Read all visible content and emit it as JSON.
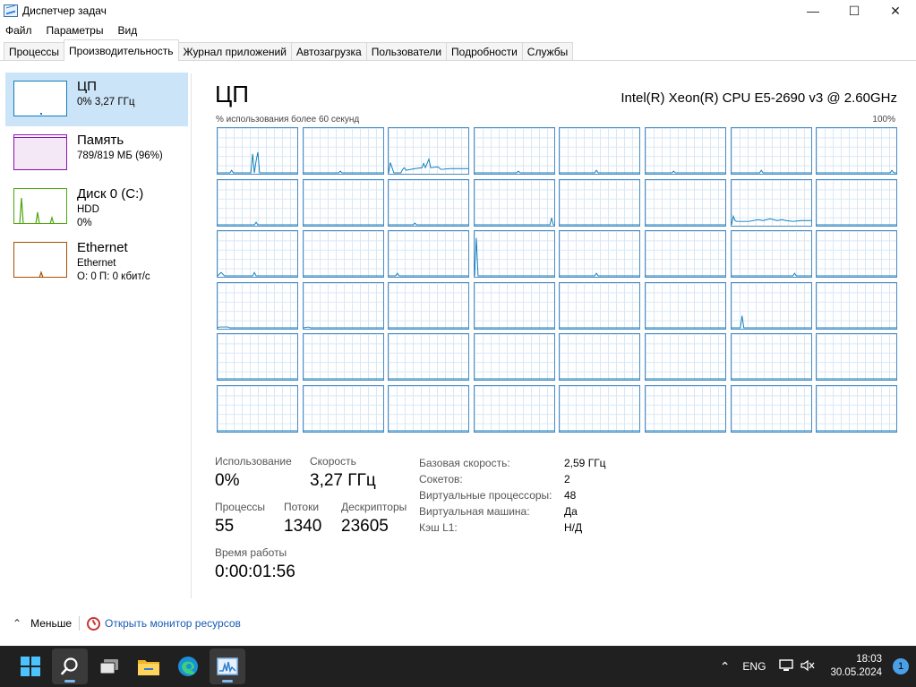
{
  "window": {
    "title": "Диспетчер задач",
    "minimize_icon": "—",
    "maximize_icon": "☐",
    "close_icon": "✕"
  },
  "menu": [
    "Файл",
    "Параметры",
    "Вид"
  ],
  "tabs": [
    "Процессы",
    "Производительность",
    "Журнал приложений",
    "Автозагрузка",
    "Пользователи",
    "Подробности",
    "Службы"
  ],
  "sidebar": {
    "items": [
      {
        "title": "ЦП",
        "sub1": "0% 3,27 ГГц",
        "sub2": "",
        "color": "#117dbb"
      },
      {
        "title": "Память",
        "sub1": "789/819 МБ (96%)",
        "sub2": "",
        "color": "#8b12ae"
      },
      {
        "title": "Диск 0 (C:)",
        "sub1": "HDD",
        "sub2": "0%",
        "color": "#4da60c"
      },
      {
        "title": "Ethernet",
        "sub1": "Ethernet",
        "sub2": "О: 0 П: 0 кбит/с",
        "color": "#a74f01"
      }
    ]
  },
  "cpu": {
    "title": "ЦП",
    "model": "Intel(R) Xeon(R) CPU E5-2690 v3 @ 2.60GHz",
    "graph_caption": "% использования более 60 секунд",
    "graph_max": "100%",
    "logical_count": 48,
    "stats": {
      "usage_label": "Использование",
      "usage": "0%",
      "speed_label": "Скорость",
      "speed": "3,27 ГГц",
      "processes_label": "Процессы",
      "processes": "55",
      "threads_label": "Потоки",
      "threads": "1340",
      "handles_label": "Дескрипторы",
      "handles": "23605",
      "uptime_label": "Время работы",
      "uptime": "0:00:01:56"
    },
    "details": [
      {
        "label": "Базовая скорость:",
        "value": "2,59 ГГц"
      },
      {
        "label": "Сокетов:",
        "value": "2"
      },
      {
        "label": "Виртуальные процессоры:",
        "value": "48"
      },
      {
        "label": "Виртуальная машина:",
        "value": "Да"
      },
      {
        "label": "Кэш L1:",
        "value": "Н/Д"
      }
    ]
  },
  "bottom": {
    "fewer_label": "Меньше",
    "resmon_label": "Открыть монитор ресурсов"
  },
  "taskbar": {
    "language": "ENG",
    "time": "18:03",
    "date": "30.05.2024",
    "notifications": "1"
  }
}
